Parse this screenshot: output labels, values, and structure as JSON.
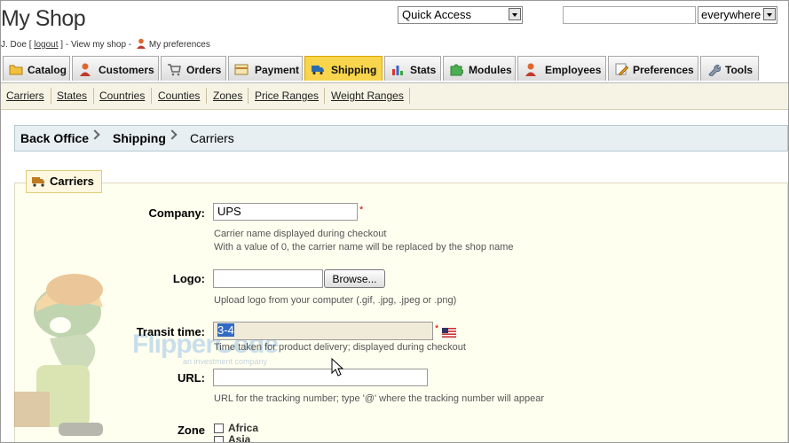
{
  "header": {
    "shop_title": "My Shop",
    "user_name": "J. Doe",
    "logout_label": "logout",
    "view_shop_label": "View my shop",
    "preferences_label": "My preferences",
    "quick_access": "Quick Access",
    "search_value": "",
    "search_scope": "everywhere"
  },
  "tabs": [
    {
      "label": "Catalog",
      "icon": "folder-icon"
    },
    {
      "label": "Customers",
      "icon": "person-icon"
    },
    {
      "label": "Orders",
      "icon": "cart-icon"
    },
    {
      "label": "Payment",
      "icon": "payment-icon"
    },
    {
      "label": "Shipping",
      "icon": "truck-icon",
      "active": true
    },
    {
      "label": "Stats",
      "icon": "bar-chart-icon"
    },
    {
      "label": "Modules",
      "icon": "puzzle-icon"
    },
    {
      "label": "Employees",
      "icon": "employee-icon"
    },
    {
      "label": "Preferences",
      "icon": "pencil-icon"
    },
    {
      "label": "Tools",
      "icon": "wrench-icon"
    }
  ],
  "subnav": [
    "Carriers",
    "States",
    "Countries",
    "Counties",
    "Zones",
    "Price Ranges",
    "Weight Ranges"
  ],
  "breadcrumb": {
    "root": "Back Office",
    "section": "Shipping",
    "page": "Carriers"
  },
  "form": {
    "legend": "Carriers",
    "company_label": "Company:",
    "company_value": "UPS",
    "company_hint1": "Carrier name displayed during checkout",
    "company_hint2": "With a value of 0, the carrier name will be replaced by the shop name",
    "logo_label": "Logo:",
    "browse_label": "Browse...",
    "logo_hint": "Upload logo from your computer (.gif, .jpg, .jpeg or .png)",
    "transit_label": "Transit time:",
    "transit_value": "3-4",
    "transit_hint": "Time taken for product delivery; displayed during checkout",
    "url_label": "URL:",
    "url_hint": "URL for the tracking number; type '@' where the tracking number will appear",
    "zone_label": "Zone",
    "zones": [
      "Africa",
      "Asia"
    ],
    "required_mark": "*"
  },
  "watermark": {
    "brand": "FlipperCode",
    "tagline": "an investment company"
  },
  "colors": {
    "active_tab": "#f8d54c",
    "subnav_bg": "#f6f3e4",
    "breadcrumb_bg": "#e7eff3",
    "form_bg": "#fffff0",
    "selection": "#316ac5"
  }
}
